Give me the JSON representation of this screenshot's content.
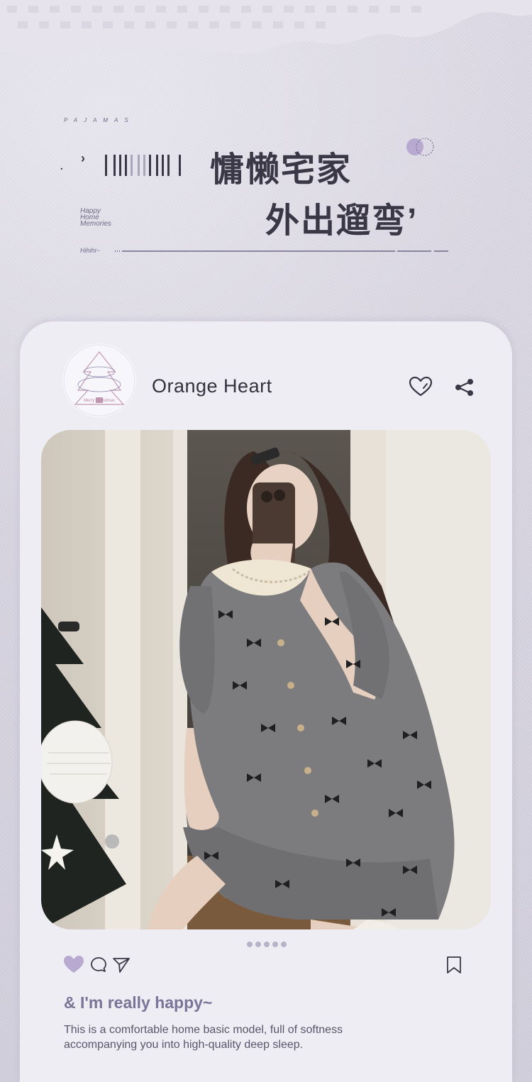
{
  "header": {
    "tag": "PAJAMAS",
    "title_line1": "慵懒宅家",
    "title_line2": "外出遛弯’",
    "happy_lines": [
      "Happy",
      "Home",
      "Memories"
    ],
    "hihihi": "Hihihi~"
  },
  "post": {
    "avatar_caption": "Merry Christmas",
    "account_name": "Orange Heart",
    "image_count": 5,
    "headline": "& I'm really happy~",
    "description": "This is a comfortable home basic model, full of softness accompanying you into high-quality deep sleep."
  },
  "icons": {
    "header_like": "heart-outline-icon",
    "header_share": "share-icon",
    "like": "heart-filled-icon",
    "comment": "comment-icon",
    "send": "send-icon",
    "bookmark": "bookmark-icon"
  },
  "colors": {
    "accent": "#7a7498",
    "heart_fill": "#b7a9d0",
    "background": "#d9d6e2",
    "card": "#eeedf3"
  }
}
